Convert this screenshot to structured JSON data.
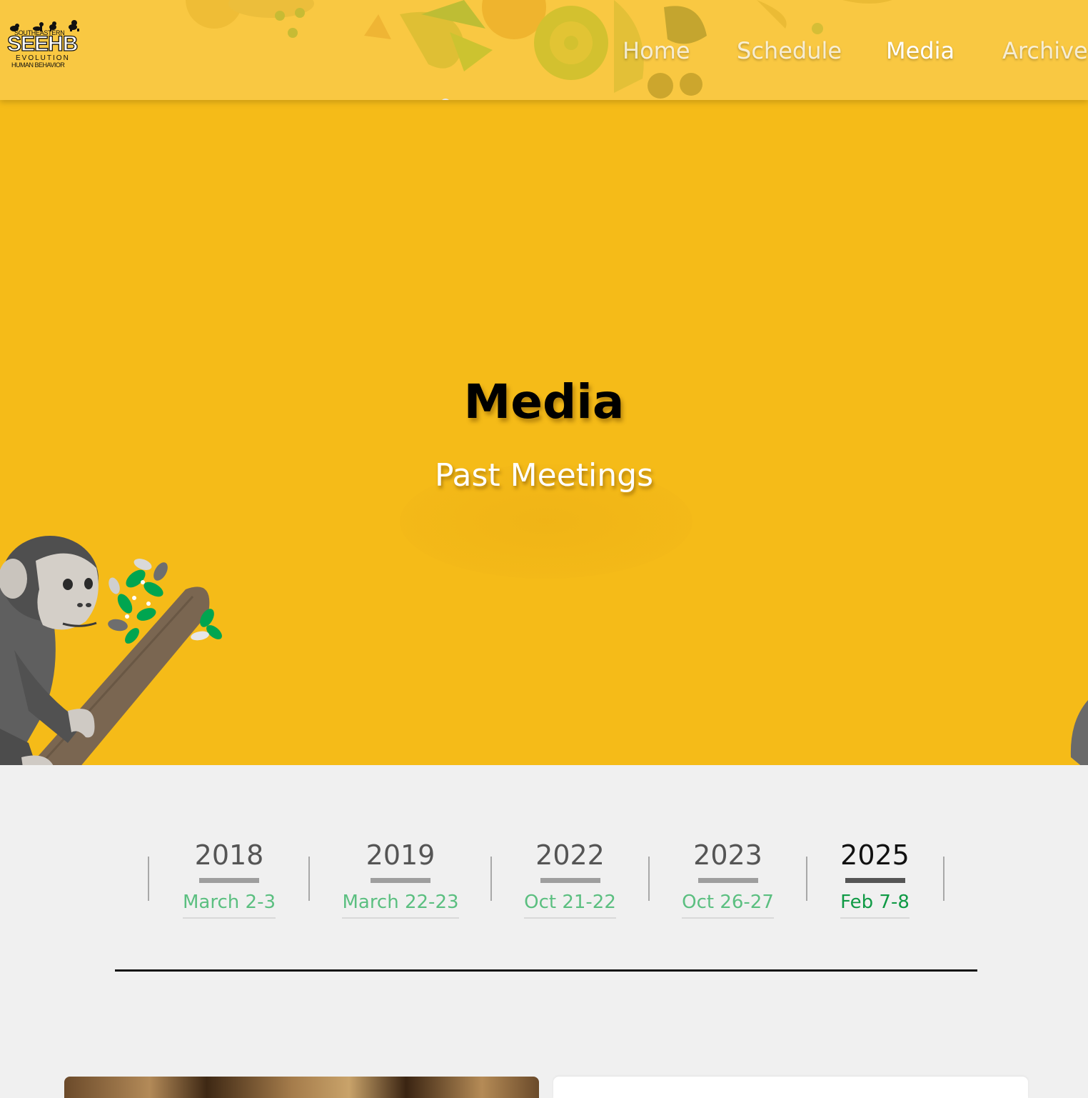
{
  "logo": {
    "top_text": "SOUTHEASTERN",
    "main_text": "SEEHB",
    "middle_text": "EVOLUTION",
    "bottom_text": "HUMAN BEHAVIOR"
  },
  "nav": {
    "items": [
      {
        "label": "Home",
        "active": false
      },
      {
        "label": "Schedule",
        "active": false
      },
      {
        "label": "Media",
        "active": true
      },
      {
        "label": "Archive",
        "active": false
      }
    ]
  },
  "hero": {
    "title": "Media",
    "subtitle": "Past Meetings"
  },
  "timeline": {
    "items": [
      {
        "year": "2018",
        "date": "March 2-3",
        "active": false
      },
      {
        "year": "2019",
        "date": "March 22-23",
        "active": false
      },
      {
        "year": "2022",
        "date": "Oct 21-22",
        "active": false
      },
      {
        "year": "2023",
        "date": "Oct 26-27",
        "active": false
      },
      {
        "year": "2025",
        "date": "Feb 7-8",
        "active": true
      }
    ]
  },
  "colors": {
    "header_bg": "#f9c842",
    "hero_bg": "#f5bb18",
    "page_bg": "#f0f0f0",
    "date_green": "#5bbf80",
    "date_green_active": "#0f9a45"
  }
}
